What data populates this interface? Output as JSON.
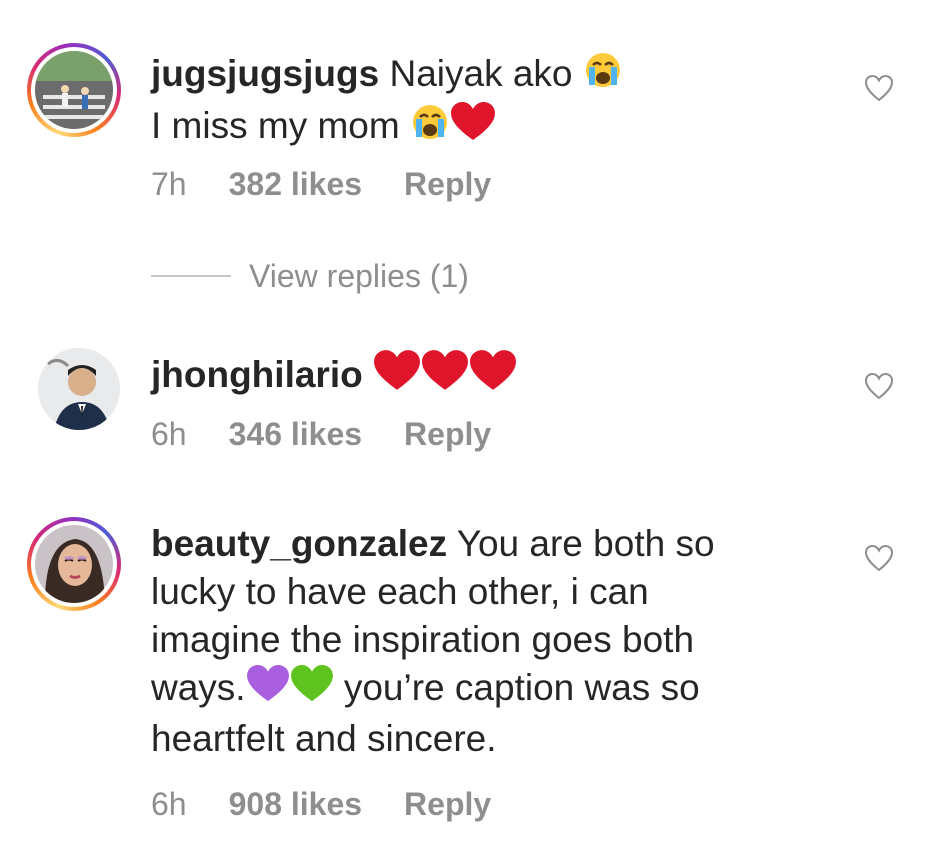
{
  "comments": [
    {
      "username": "jugsjugsjugs",
      "text_line1": " Naiyak ako ",
      "text_line2": "I miss my mom ",
      "time": "7h",
      "likes": "382 likes",
      "reply": "Reply",
      "view_replies": "View replies (1)",
      "avatar_style": "story-ring"
    },
    {
      "username": "jhonghilario",
      "time": "6h",
      "likes": "346 likes",
      "reply": "Reply",
      "avatar_style": "plain"
    },
    {
      "username": "beauty_gonzalez",
      "text_part1": " You are both so lucky to have each other, i can imagine the inspiration goes both ways.",
      "text_part2": " you’re caption was so heartfelt and sincere.",
      "time": "6h",
      "likes": "908 likes",
      "reply": "Reply",
      "avatar_style": "story-ring"
    }
  ],
  "icons": {
    "like": "heart-outline-icon",
    "crying": "loudly-crying-face-emoji",
    "red_heart": "red-heart-emoji",
    "purple_heart": "purple-heart-emoji",
    "green_heart": "green-heart-emoji"
  },
  "colors": {
    "text": "#262626",
    "meta": "#8e8e8e",
    "red_heart": "#e0142b",
    "purple_heart": "#a95fe0",
    "green_heart": "#5fc31f"
  }
}
